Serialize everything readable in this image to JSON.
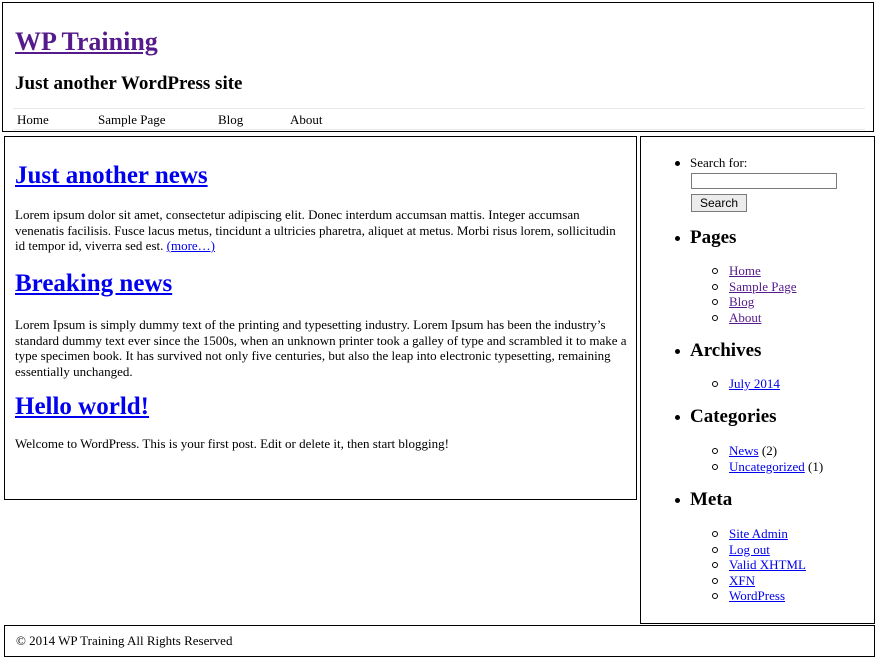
{
  "site": {
    "title": "WP Training",
    "description": "Just another WordPress site"
  },
  "nav": {
    "items": [
      {
        "label": "Home"
      },
      {
        "label": "Sample Page"
      },
      {
        "label": "Blog"
      },
      {
        "label": "About"
      }
    ]
  },
  "posts": [
    {
      "title": "Just another news",
      "body": "Lorem ipsum dolor sit amet, consectetur adipiscing elit. Donec interdum accumsan mattis. Integer accumsan venenatis facilisis. Fusce lacus metus, tincidunt a ultricies pharetra, aliquet at metus. Morbi risus lorem, sollicitudin id tempor id, viverra sed est.",
      "more": "(more…)"
    },
    {
      "title": "Breaking news",
      "body": "Lorem Ipsum is simply dummy text of the printing and typesetting industry. Lorem Ipsum has been the industry’s standard dummy text ever since the 1500s, when an unknown printer took a galley of type and scrambled it to make a type specimen book. It has survived not only five centuries, but also the leap into electronic typesetting, remaining essentially unchanged."
    },
    {
      "title": "Hello world!",
      "body": "Welcome to WordPress. This is your first post. Edit or delete it, then start blogging!"
    }
  ],
  "sidebar": {
    "search": {
      "label": "Search for:",
      "button": "Search",
      "value": ""
    },
    "pages": {
      "heading": "Pages",
      "items": [
        "Home",
        "Sample Page",
        "Blog",
        "About"
      ]
    },
    "archives": {
      "heading": "Archives",
      "items": [
        "July 2014"
      ]
    },
    "categories": {
      "heading": "Categories",
      "items": [
        {
          "label": "News",
          "count": "(2)"
        },
        {
          "label": "Uncategorized",
          "count": "(1)"
        }
      ]
    },
    "meta": {
      "heading": "Meta",
      "items": [
        "Site Admin",
        "Log out",
        "Valid XHTML",
        "XFN",
        "WordPress"
      ]
    }
  },
  "footer": {
    "text": "© 2014 WP Training All Rights Reserved"
  },
  "colors": {
    "link": "#0000ee",
    "visited": "#551a8b",
    "border": "#000000"
  }
}
